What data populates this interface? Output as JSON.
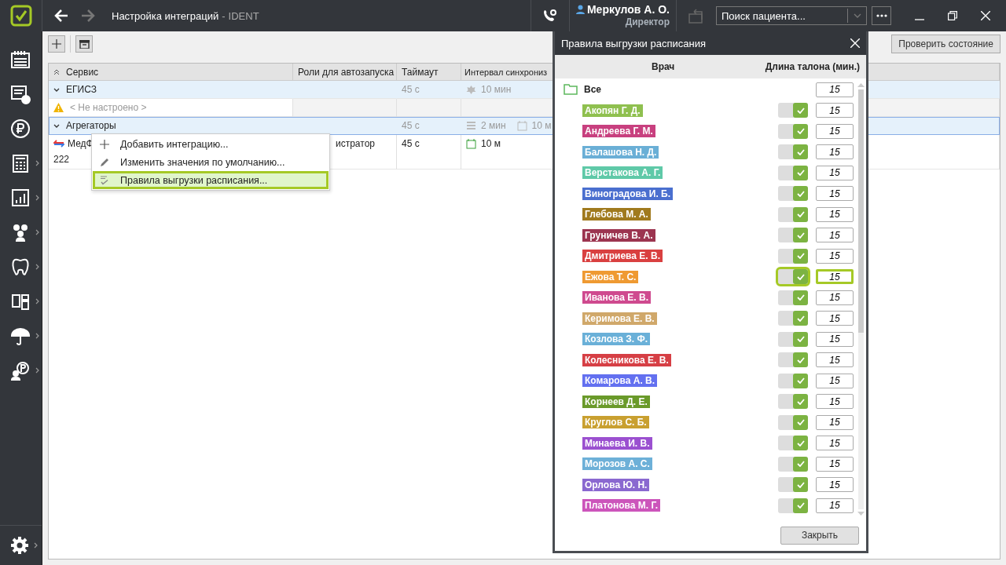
{
  "titlebar": {
    "title": "Настройка интеграций",
    "title_separator": "-",
    "app": "IDENT",
    "user_name": "Меркулов А. О.",
    "user_role": "Директор",
    "search": {
      "placeholder": "Поиск пациента..."
    }
  },
  "sidebar": {
    "items": [
      {
        "kind": "calendar",
        "submenu": false
      },
      {
        "kind": "checklist",
        "submenu": false
      },
      {
        "kind": "ruble",
        "submenu": false
      },
      {
        "kind": "calculator",
        "submenu": true
      },
      {
        "kind": "chart",
        "submenu": true
      },
      {
        "kind": "people",
        "submenu": true
      },
      {
        "kind": "tooth",
        "submenu": true
      },
      {
        "kind": "devices",
        "submenu": true
      },
      {
        "kind": "umbrella",
        "submenu": true
      },
      {
        "kind": "payer",
        "submenu": true
      }
    ],
    "bottom": {
      "kind": "gear",
      "submenu": true
    }
  },
  "toolbar": {
    "check_button": "Проверить состояние"
  },
  "table": {
    "columns": [
      "Сервис",
      "Роли для автозапуска",
      "Таймаут",
      "Интервал синхрониз"
    ],
    "rows": [
      {
        "kind": "group",
        "name": "ЕГИСЗ",
        "expanded": true,
        "selected": false,
        "timeout": "45 с",
        "intervals": [
          {
            "kind": "emblem",
            "text": "10 мин"
          }
        ]
      },
      {
        "kind": "warning",
        "name": "< Не настроено >"
      },
      {
        "kind": "group",
        "name": "Агрегаторы",
        "expanded": true,
        "selected": true,
        "timeout": "45 с",
        "intervals": [
          {
            "kind": "list",
            "text": "2 мин"
          },
          {
            "kind": "calendar",
            "text": "10 м"
          }
        ]
      },
      {
        "kind": "item",
        "name": "МедФ",
        "extra": "222",
        "roles": "истратор",
        "timeout": "45 с",
        "intervals": [
          {
            "kind": "active",
            "text": "10 м"
          }
        ]
      }
    ]
  },
  "context_menu": {
    "items": [
      {
        "kind": "add",
        "label": "Добавить интеграцию...",
        "selected": false
      },
      {
        "kind": "edit",
        "label": "Изменить значения по умолчанию...",
        "selected": false
      },
      {
        "kind": "rules",
        "label": "Правила выгрузки расписания...",
        "selected": true
      }
    ]
  },
  "dialog": {
    "title": "Правила выгрузки расписания",
    "columns": [
      "Врач",
      "Длина талона (мин.)"
    ],
    "all": {
      "label": "Все",
      "value": "15"
    },
    "doctors": [
      {
        "name": "Акопян Г. Д.",
        "color": "#8fc04f",
        "on": true,
        "value": "15",
        "focused": false
      },
      {
        "name": "Андреева Г. М.",
        "color": "#c8407f",
        "on": true,
        "value": "15",
        "focused": false
      },
      {
        "name": "Балашова Н. Д.",
        "color": "#6aafd6",
        "on": true,
        "value": "15",
        "focused": false
      },
      {
        "name": "Верстакова А. Г.",
        "color": "#5fc9a8",
        "on": true,
        "value": "15",
        "focused": false
      },
      {
        "name": "Виноградова И. Б.",
        "color": "#4a6fcf",
        "on": true,
        "value": "15",
        "focused": false
      },
      {
        "name": "Глебова М. А.",
        "color": "#a07a1e",
        "on": true,
        "value": "15",
        "focused": false
      },
      {
        "name": "Груничев В. А.",
        "color": "#9c3550",
        "on": true,
        "value": "15",
        "focused": false
      },
      {
        "name": "Дмитриева Е. В.",
        "color": "#d94040",
        "on": true,
        "value": "15",
        "focused": false
      },
      {
        "name": "Ежова Т. С.",
        "color": "#ef9a32",
        "on": true,
        "value": "15",
        "focused": true
      },
      {
        "name": "Иванова Е. В.",
        "color": "#cf4a8f",
        "on": true,
        "value": "15",
        "focused": false
      },
      {
        "name": "Керимова Е. В.",
        "color": "#d0a86a",
        "on": true,
        "value": "15",
        "focused": false
      },
      {
        "name": "Козлова З. Ф.",
        "color": "#6ab0d8",
        "on": true,
        "value": "15",
        "focused": false
      },
      {
        "name": "Колесникова Е. В.",
        "color": "#d63f45",
        "on": true,
        "value": "15",
        "focused": false
      },
      {
        "name": "Комарова А. В.",
        "color": "#6370f0",
        "on": true,
        "value": "15",
        "focused": false
      },
      {
        "name": "Корнеев Д. Е.",
        "color": "#6a9a2a",
        "on": true,
        "value": "15",
        "focused": false
      },
      {
        "name": "Круглов С. Б.",
        "color": "#c9a030",
        "on": true,
        "value": "15",
        "focused": false
      },
      {
        "name": "Минаева И. В.",
        "color": "#9b50d0",
        "on": true,
        "value": "15",
        "focused": false
      },
      {
        "name": "Морозов А. С.",
        "color": "#6db0d8",
        "on": true,
        "value": "15",
        "focused": false
      },
      {
        "name": "Орлова Ю. Н.",
        "color": "#8a68d0",
        "on": true,
        "value": "15",
        "focused": false
      },
      {
        "name": "Платонова М. Г.",
        "color": "#cc55bb",
        "on": true,
        "value": "15",
        "focused": false
      }
    ],
    "close_button": "Закрыть"
  }
}
